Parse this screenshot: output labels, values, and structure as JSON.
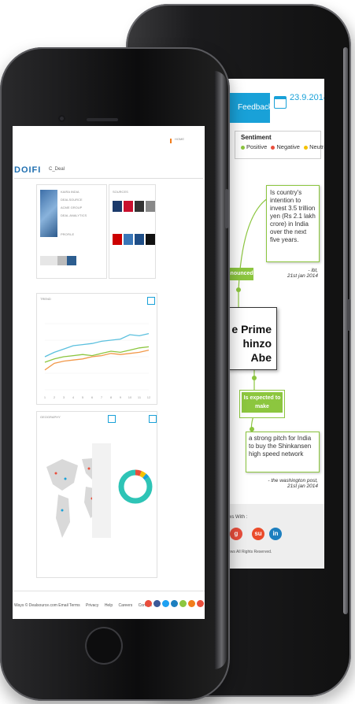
{
  "back_screen": {
    "tab_label": "Feedback",
    "date": "23.9.2014",
    "sentiment": {
      "title": "Sentiment",
      "items": [
        {
          "label": "Positive",
          "color": "#8cc63f"
        },
        {
          "label": "Negative",
          "color": "#e94e3c"
        },
        {
          "label": "Neutral",
          "color": "#f5c200"
        }
      ]
    },
    "quote_1": {
      "text": "Is country's intention to invest 3.5 trillion yen (Rs 2.1 lakh crore) in India over the next five years.",
      "attribution_1": "- ibt,",
      "attribution_2": "21st jan 2014"
    },
    "announced_label": "nnounced",
    "center_node": {
      "line1": "e Prime",
      "line2": "hinzo Abe"
    },
    "expected_label": "Is expected to make",
    "quote_2": {
      "text": "a strong pitch for India to buy the Shinkansen high speed network",
      "attribution_1": "- the washington post,",
      "attribution_2": "21st jan 2014"
    },
    "share_label": "ws With :",
    "social": [
      {
        "name": "google",
        "glyph": "g",
        "color": "#e94e3c"
      },
      {
        "name": "stumbleupon",
        "glyph": "su",
        "color": "#ea4b2a"
      },
      {
        "name": "linkedin",
        "glyph": "in",
        "color": "#1d7fbf"
      }
    ],
    "rights": "ews All Rights Reserved."
  },
  "front_screen": {
    "status_text": "HOME",
    "logo": "DOIFI",
    "header_title": "C_Deal",
    "profile_lines": [
      "KAIRA INDIA",
      "DEALSOURCE",
      "ACME GROUP",
      "DEAL ANALYTICS"
    ],
    "stats_label": "PROFILE",
    "sources_label": "SOURCES",
    "chart_label": "TREND",
    "map_label": "GEOGRAPHY",
    "footer_text": "Ways © Dealsource.com Email",
    "footer_links": [
      "Terms",
      "Privacy",
      "Help",
      "Careers",
      "Contact"
    ],
    "social_colors": [
      "#e94e3c",
      "#3b5998",
      "#1da1f2",
      "#1d7fbf",
      "#8cc63f",
      "#f27d1b",
      "#e94e3c"
    ]
  },
  "chart_data": {
    "type": "line",
    "title": "",
    "xlabel": "",
    "ylabel": "",
    "categories": [
      "1",
      "2",
      "3",
      "4",
      "5",
      "6",
      "7",
      "8",
      "9",
      "10",
      "11",
      "12"
    ],
    "series": [
      {
        "color": "#5bc0de",
        "values": [
          30,
          34,
          37,
          40,
          41,
          42,
          44,
          45,
          46,
          50,
          49,
          51
        ]
      },
      {
        "color": "#8cc63f",
        "values": [
          25,
          28,
          30,
          31,
          32,
          31,
          33,
          35,
          34,
          36,
          38,
          39
        ]
      },
      {
        "color": "#f2994a",
        "values": [
          18,
          24,
          26,
          27,
          28,
          30,
          31,
          33,
          32,
          33,
          34,
          36
        ]
      }
    ],
    "ylim": [
      0,
      60
    ]
  },
  "donut_data": {
    "type": "pie",
    "values": [
      6,
      5,
      4,
      85
    ],
    "colors": [
      "#e94e3c",
      "#f5c200",
      "#19a1d8",
      "#2ec4b6"
    ]
  }
}
